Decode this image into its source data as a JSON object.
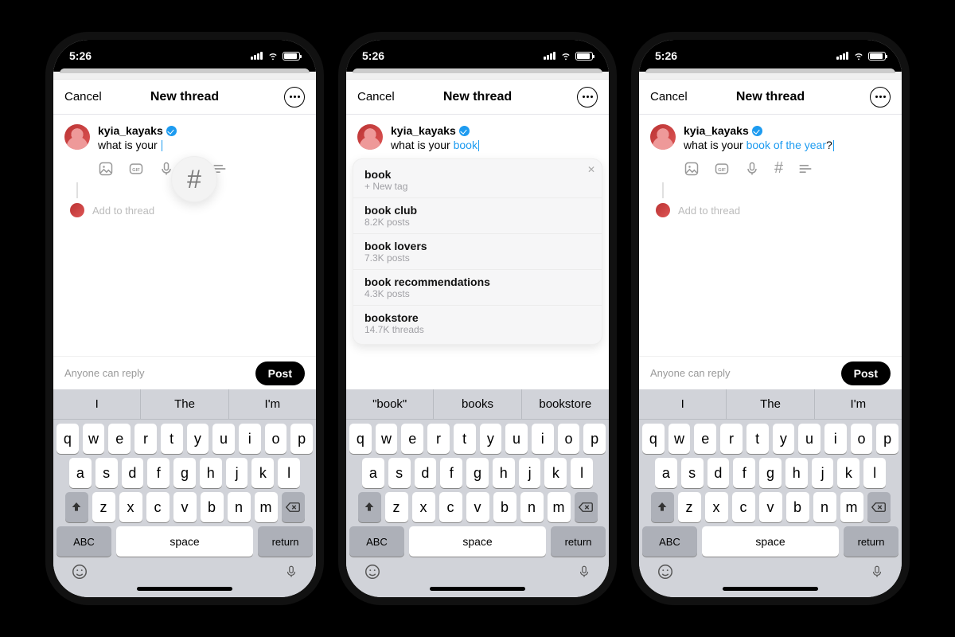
{
  "status": {
    "time": "5:26"
  },
  "nav": {
    "cancel": "Cancel",
    "title": "New thread"
  },
  "user": {
    "name": "kyia_kayaks"
  },
  "composer": {
    "text_plain": "what is your ",
    "text_highlight_mid": "book",
    "text_highlight_full": "book of the year",
    "text_after": "?",
    "add_thread": "Add to thread"
  },
  "footer": {
    "audience": "Anyone can reply",
    "post": "Post"
  },
  "suggestions": {
    "set_a": [
      "I",
      "The",
      "I'm"
    ],
    "set_b": [
      "\"book\"",
      "books",
      "bookstore"
    ]
  },
  "dropdown": [
    {
      "name": "book",
      "sub": "+ New tag"
    },
    {
      "name": "book club",
      "sub": "8.2K posts"
    },
    {
      "name": "book lovers",
      "sub": "7.3K posts"
    },
    {
      "name": "book recommendations",
      "sub": "4.3K posts"
    },
    {
      "name": "bookstore",
      "sub": "14.7K threads"
    }
  ],
  "keyboard": {
    "row1": [
      "q",
      "w",
      "e",
      "r",
      "t",
      "y",
      "u",
      "i",
      "o",
      "p"
    ],
    "row2": [
      "a",
      "s",
      "d",
      "f",
      "g",
      "h",
      "j",
      "k",
      "l"
    ],
    "row3": [
      "z",
      "x",
      "c",
      "v",
      "b",
      "n",
      "m"
    ],
    "abc": "ABC",
    "space": "space",
    "ret": "return"
  }
}
